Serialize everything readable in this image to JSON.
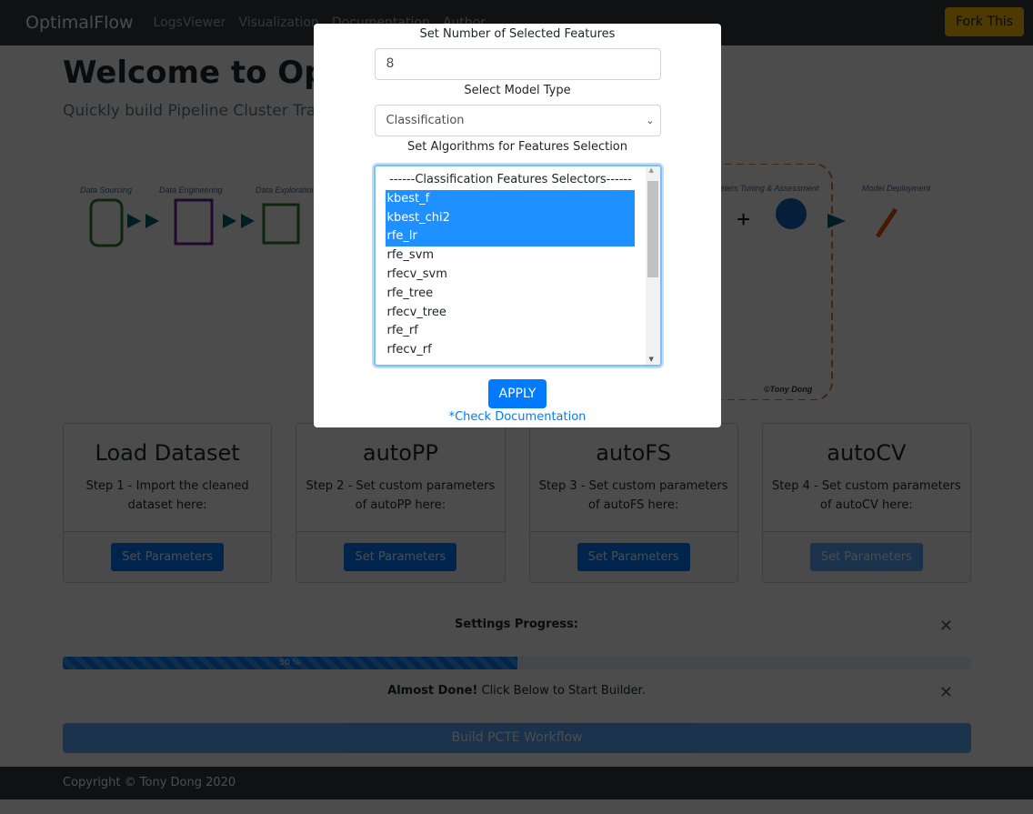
{
  "nav": {
    "brand": "OptimalFlow",
    "links": [
      "LogsViewer",
      "Visualization",
      "Documentation",
      "Author"
    ],
    "fork": "Fork This"
  },
  "hero": {
    "title": "Welcome to OptimalFlow",
    "subtitle": "Quickly build Pipeline Cluster Traversal Experiments"
  },
  "diagram": {
    "stages": [
      "Data Sourcing",
      "Data Engineering",
      "Data Exploration",
      "Parameters Tuning & Assessment",
      "Model Deployment"
    ],
    "credit": "©Tony Dong"
  },
  "cards": [
    {
      "title": "Load Dataset",
      "text": "Step 1 - Import the cleaned dataset here:",
      "button": "Set Parameters"
    },
    {
      "title": "autoPP",
      "text": "Step 2 - Set custom parameters of autoPP here:",
      "button": "Set Parameters"
    },
    {
      "title": "autoFS",
      "text": "Step 3 - Set custom parameters of autoFS here:",
      "button": "Set Parameters"
    },
    {
      "title": "autoCV",
      "text": "Step 4 - Set custom parameters of autoCV here:",
      "button": "Set Parameters"
    }
  ],
  "progress": {
    "title": "Settings Progress:",
    "percent": 50,
    "label": "50 %"
  },
  "alert": {
    "strong": "Almost Done!",
    "text": " Click Below to Start Builder."
  },
  "build": "Build PCTE Workflow",
  "footer": "Copyright © Tony Dong 2020",
  "modal": {
    "num_label": "Set Number of Selected Features",
    "num_value": "8",
    "type_label": "Select Model Type",
    "type_value": "Classification",
    "algo_label": "Set Algorithms for Features Selection",
    "options": [
      {
        "label": "------Classification Features Selectors------",
        "selected": false
      },
      {
        "label": "kbest_f",
        "selected": true
      },
      {
        "label": "kbest_chi2",
        "selected": true
      },
      {
        "label": "rfe_lr",
        "selected": true
      },
      {
        "label": "rfe_svm",
        "selected": false
      },
      {
        "label": "rfecv_svm",
        "selected": false
      },
      {
        "label": "rfe_tree",
        "selected": false
      },
      {
        "label": "rfecv_tree",
        "selected": false
      },
      {
        "label": "rfe_rf",
        "selected": false
      },
      {
        "label": "rfecv_rf",
        "selected": false
      }
    ],
    "apply": "APPLY",
    "doc_link": "*Check Documentation"
  }
}
